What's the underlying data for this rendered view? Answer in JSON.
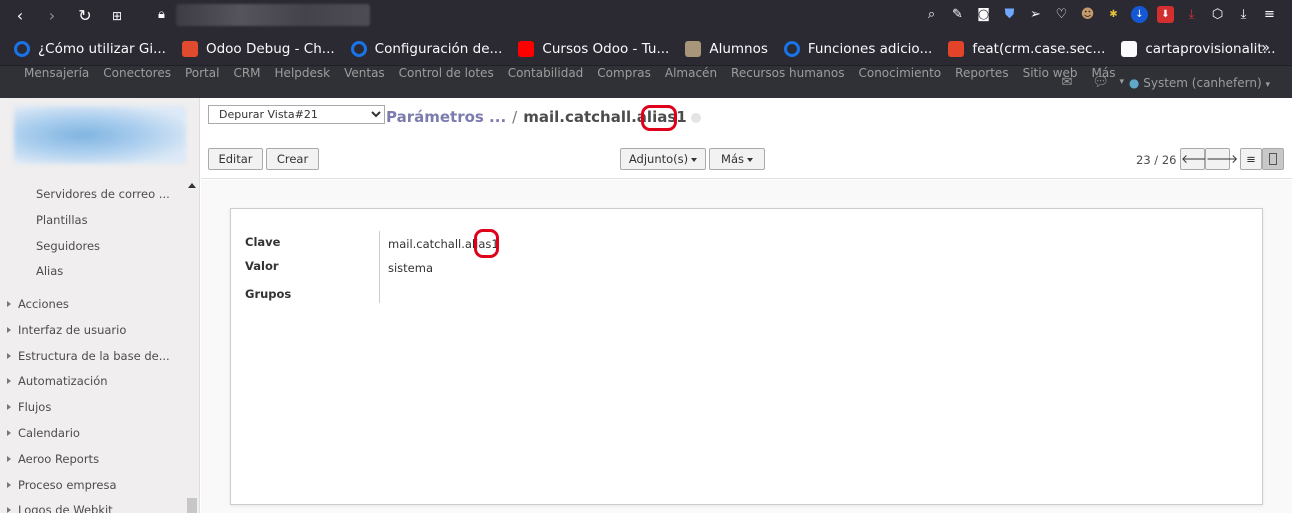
{
  "browser": {
    "nav_icons": [
      "back-icon",
      "forward-icon",
      "reload-icon",
      "apps-icon"
    ],
    "toolbar_icons": [
      "zoom-icon",
      "edit-icon",
      "camera-icon",
      "shield-icon",
      "send-icon",
      "heart-icon",
      "avatar-ext-icon",
      "ext-icon",
      "download-ext-icon",
      "ext-red-icon",
      "ext-download-red-icon",
      "box-icon",
      "download-icon",
      "menu-icon"
    ],
    "bookmarks": [
      {
        "label": "¿Cómo utilizar Gi...",
        "icon": "circle-icon",
        "color": "#1a73e8"
      },
      {
        "label": "Odoo Debug - Ch...",
        "icon": "chrome-icon",
        "color": "#e04b2f"
      },
      {
        "label": "Configuración de...",
        "icon": "circle-icon",
        "color": "#1a73e8"
      },
      {
        "label": "Cursos Odoo - Tu...",
        "icon": "youtube-icon",
        "color": "#ff0000"
      },
      {
        "label": "Alumnos",
        "icon": "photo-icon",
        "color": "#a8967a"
      },
      {
        "label": "Funciones adicio...",
        "icon": "circle-icon",
        "color": "#1a73e8"
      },
      {
        "label": "feat(crm.case.sec...",
        "icon": "gitlab-icon",
        "color": "#e24329"
      },
      {
        "label": "cartaprovisionalit...",
        "icon": "document-icon",
        "color": "#fbfbfe"
      }
    ],
    "more_label": "»"
  },
  "odoo_menu": {
    "items": [
      "Mensajería",
      "Conectores",
      "Portal",
      "CRM",
      "Helpdesk",
      "Ventas",
      "Control de lotes",
      "Contabilidad",
      "Compras",
      "Almacén",
      "Recursos humanos",
      "Conocimiento",
      "Reportes",
      "Sitio web",
      "Más"
    ],
    "user": "System (canhefern)"
  },
  "sidebar": {
    "sub_items": [
      "Servidores de correo ...",
      "Plantillas",
      "Seguidores",
      "Alias"
    ],
    "groups": [
      "Acciones",
      "Interfaz de usuario",
      "Estructura de la base de...",
      "Automatización",
      "Flujos",
      "Calendario",
      "Aeroo Reports",
      "Proceso empresa",
      "Logos de Webkit"
    ]
  },
  "control_panel": {
    "debug_select": "Depurar Vista#21",
    "breadcrumb_parent": "Parámetros ...",
    "breadcrumb_sep": "/",
    "breadcrumb_current": "mail.catchall.alias1",
    "edit_label": "Editar",
    "create_label": "Crear",
    "attachments_label": "Adjunto(s)",
    "more_label": "Más",
    "pager": "23 / 26"
  },
  "form": {
    "key_label": "Clave",
    "key_value": "mail.catchall.alias1",
    "value_label": "Valor",
    "value_value": "sistema",
    "groups_label": "Grupos"
  },
  "colors": {
    "highlight": "#e0001a",
    "breadcrumb_link": "#7c7bad",
    "menu_bg": "#2f3136"
  }
}
